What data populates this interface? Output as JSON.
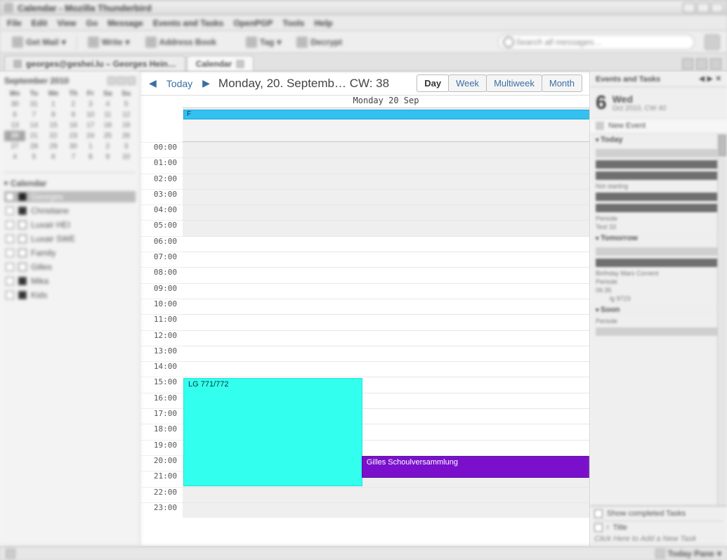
{
  "window": {
    "title": "Calendar - Mozilla Thunderbird"
  },
  "menu": {
    "items": [
      "File",
      "Edit",
      "View",
      "Go",
      "Message",
      "Events and Tasks",
      "OpenPGP",
      "Tools",
      "Help"
    ]
  },
  "toolbar": {
    "getmail": "Get Mail",
    "write": "Write",
    "address": "Address Book",
    "tag": "Tag",
    "decrypt": "Decrypt",
    "search_placeholder": "Search all messages…"
  },
  "tabs": {
    "mail": "georges@geshei.lu – Georges Hein…",
    "calendar": "Calendar"
  },
  "minical": {
    "title": "September  2010",
    "dow": [
      "Mo",
      "Tu",
      "We",
      "Th",
      "Fr",
      "Sa",
      "Su"
    ],
    "today_cell": 20
  },
  "calendars": {
    "label": "Calendar",
    "items": [
      {
        "name": "Georges",
        "color": "#222",
        "selected": true
      },
      {
        "name": "Christiane",
        "color": "#333"
      },
      {
        "name": "Luxair HEI",
        "color": "#fff"
      },
      {
        "name": "Luxair SWE",
        "color": "#fff"
      },
      {
        "name": "Family",
        "color": "#fff"
      },
      {
        "name": "Gilles",
        "color": "#fff"
      },
      {
        "name": "Mika",
        "color": "#333"
      },
      {
        "name": "Kids",
        "color": "#333"
      }
    ]
  },
  "calview": {
    "today": "Today",
    "title": "Monday, 20. Septemb…   CW: 38",
    "tabs": {
      "day": "Day",
      "week": "Week",
      "multi": "Multiweek",
      "month": "Month"
    },
    "dayheader": "Monday 20 Sep",
    "allday_event": "F",
    "hours": [
      "00:00",
      "01:00",
      "02:00",
      "03:00",
      "04:00",
      "05:00",
      "06:00",
      "07:00",
      "08:00",
      "09:00",
      "10:00",
      "11:00",
      "12:00",
      "13:00",
      "14:00",
      "15:00",
      "16:00",
      "17:00",
      "18:00",
      "19:00",
      "20:00",
      "21:00",
      "22:00",
      "23:00"
    ],
    "off_hours_end": 5,
    "off_hours_start": 20,
    "event1": "LG 771/772",
    "event2": "Gilles Schoulversammlung"
  },
  "rightpane": {
    "title": "Events and Tasks",
    "bignum": "6",
    "dow": "Wed",
    "sub": "Oct 2010, CW 40",
    "newevent": "New Event",
    "sect_today": "Today",
    "sect_tomorrow": "Tomorrow",
    "sect_soon": "Soon",
    "lbl_periode": "Periode",
    "lbl_test": "Test 33",
    "lbl_lg": "lg 9723",
    "lbl_time": "06:35",
    "lbl_not": "Not starting",
    "lbl_bday": "Birthday Mars Corvent",
    "tasks_show": "Show completed Tasks",
    "tasks_title": "Title",
    "tasks_add": "Click Here to Add a New Task"
  },
  "status": {
    "todaypane": "Today Pane"
  }
}
